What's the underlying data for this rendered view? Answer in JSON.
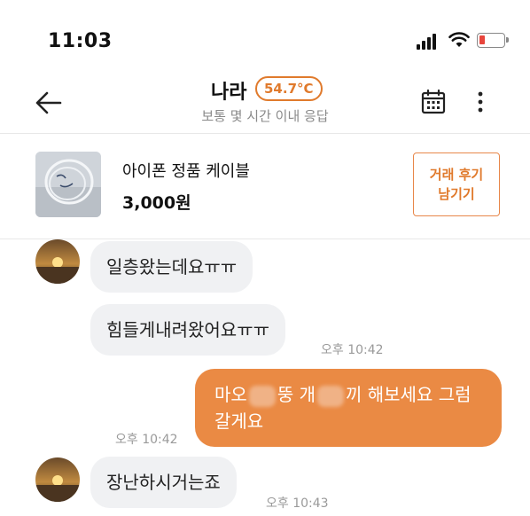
{
  "status_bar": {
    "time": "11:03"
  },
  "header": {
    "name": "나라",
    "temperature": "54.7°C",
    "subtitle": "보통 몇 시간 이내 응답"
  },
  "product": {
    "title": "아이폰 정품 케이블",
    "price": "3,000원",
    "review_button": {
      "line1": "거래 후기",
      "line2": "남기기"
    }
  },
  "colors": {
    "accent": "#ea8a44",
    "badge": "#e07a2c",
    "bubble_in": "#f0f1f3"
  },
  "messages": [
    {
      "text": "일층왔는데요ㅠㅠ",
      "time": ""
    },
    {
      "text": "힘들게내려왔어요ㅠㅠ",
      "time": "오후 10:42"
    },
    {
      "text_a": "마오",
      "text_b": "뚱 개",
      "text_c": "끼 해보세요 그럼",
      "text_d": "갈게요",
      "time": "오후 10:42"
    },
    {
      "text": "장난하시거는죠",
      "time": "오후 10:43"
    }
  ]
}
